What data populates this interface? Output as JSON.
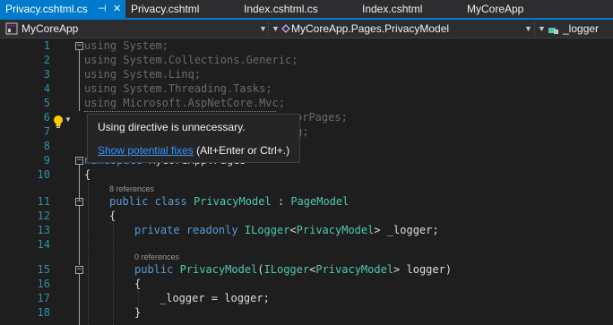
{
  "tabs": [
    {
      "label": "Privacy.cshtml.cs",
      "active": true
    },
    {
      "label": "Privacy.cshtml"
    },
    {
      "label": "Index.cshtml.cs"
    },
    {
      "label": "Index.cshtml"
    },
    {
      "label": "MyCoreApp"
    }
  ],
  "tab_icons": {
    "pin": "pin-icon",
    "close": "close-icon"
  },
  "navbar": {
    "project": "MyCoreApp",
    "class": "MyCoreApp.Pages.PrivacyModel",
    "member": "_logger"
  },
  "line_numbers": [
    "1",
    "2",
    "3",
    "4",
    "5",
    "6",
    "7",
    "8",
    "9",
    "10",
    "11",
    "12",
    "13",
    "14",
    "15",
    "16",
    "17",
    "18"
  ],
  "code": {
    "l1_kw": "using",
    "l1_rest": " System;",
    "l2_kw": "using",
    "l2_rest": " System.Collections.Generic;",
    "l3_kw": "using",
    "l3_rest": " System.Linq;",
    "l4_kw": "using",
    "l4_rest": " System.Threading.Tasks;",
    "l5_kw": "using",
    "l5_rest": " Microsoft.AspNetCore.Mvc;",
    "l6_tail": "orPages;",
    "l7_tail": "g;",
    "l9_kw": "namespace",
    "l9_rest": " MyCoreApp.Pages",
    "l10": "{",
    "refs11": "8 references",
    "l11_kw1": "public",
    "l11_kw2": "class",
    "l11_type": "PrivacyModel",
    "l11_colon": " : ",
    "l11_base": "PageModel",
    "l12": "{",
    "l13_kw1": "private",
    "l13_kw2": "readonly",
    "l13_type": "ILogger",
    "l13_lt": "<",
    "l13_arg": "PrivacyModel",
    "l13_tail": "> _logger;",
    "refs15": "0 references",
    "l15_kw": "public",
    "l15_type": "PrivacyModel",
    "l15_open": "(",
    "l15_ptype": "ILogger",
    "l15_lt": "<",
    "l15_arg": "PrivacyModel",
    "l15_tail": "> logger)",
    "l16": "{",
    "l17": "_logger = logger;",
    "l18": "}"
  },
  "tooltip": {
    "message": "Using directive is unnecessary.",
    "link": "Show potential fixes",
    "shortcut": "(Alt+Enter or Ctrl+.)"
  },
  "colors": {
    "accent": "#007acc",
    "keyword": "#569cd6",
    "type": "#4ec9b0",
    "line_number": "#2b91af",
    "link": "#3794ff"
  }
}
